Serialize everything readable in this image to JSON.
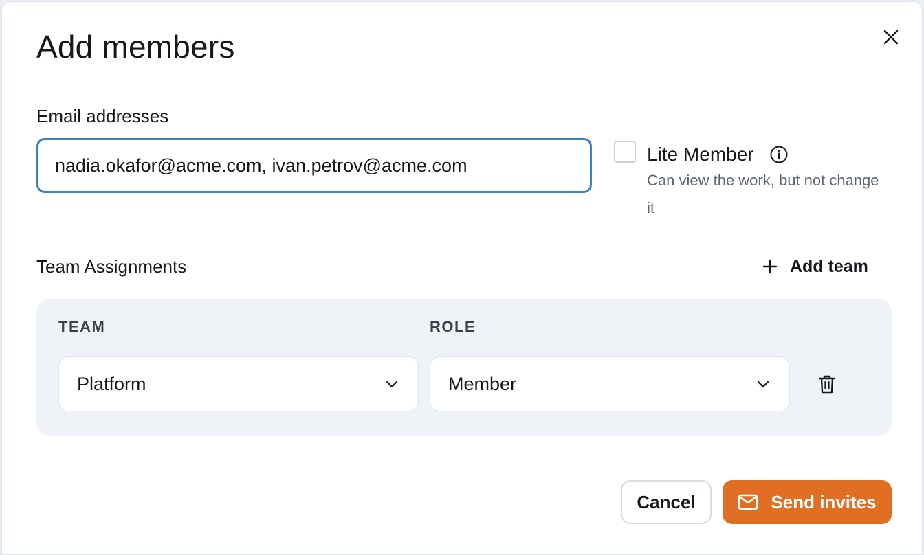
{
  "dialog": {
    "title": "Add members",
    "close_icon": "close-icon"
  },
  "email": {
    "label": "Email addresses",
    "value": "nadia.okafor@acme.com, ivan.petrov@acme.com"
  },
  "lite_member": {
    "checked": false,
    "label": "Lite Member",
    "info_icon": "info-icon",
    "description": "Can view the work, but not change it"
  },
  "team_assignments": {
    "label": "Team Assignments",
    "add_team_label": "Add team",
    "add_icon": "plus-icon",
    "columns": {
      "team": "TEAM",
      "role": "ROLE"
    },
    "rows": [
      {
        "team": "Platform",
        "role": "Member",
        "delete_icon": "trash-icon"
      }
    ]
  },
  "footer": {
    "cancel_label": "Cancel",
    "send_label": "Send invites",
    "send_icon": "mail-icon"
  },
  "colors": {
    "accent": "#e06f24",
    "focus_border": "#3b82c4",
    "panel_bg": "#eff3f8"
  }
}
